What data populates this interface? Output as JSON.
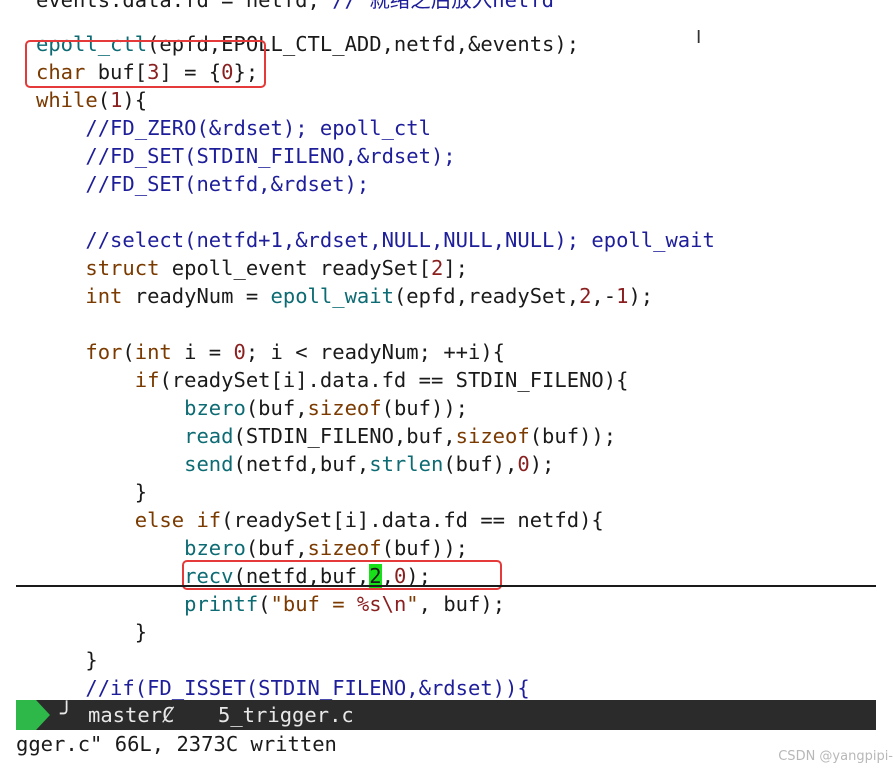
{
  "editor": {
    "lines": [
      [
        [
          "def",
          "events.data.fd = netfd; "
        ],
        [
          "cm",
          "// 就绪之后放入netfd"
        ]
      ],
      [
        [
          "fn",
          "epoll_ctl"
        ],
        [
          "def",
          "(epfd,EPOLL_CTL_ADD,netfd,&events);"
        ]
      ],
      [
        [
          "kw",
          "char"
        ],
        [
          "def",
          " buf["
        ],
        [
          "num",
          "3"
        ],
        [
          "def",
          "] = {"
        ],
        [
          "num",
          "0"
        ],
        [
          "def",
          "};"
        ]
      ],
      [
        [
          "kw",
          "while"
        ],
        [
          "def",
          "("
        ],
        [
          "num",
          "1"
        ],
        [
          "def",
          "){"
        ]
      ],
      [
        [
          "def",
          "    "
        ],
        [
          "cm",
          "//FD_ZERO(&rdset); epoll_ctl"
        ]
      ],
      [
        [
          "def",
          "    "
        ],
        [
          "cm",
          "//FD_SET(STDIN_FILENO,&rdset);"
        ]
      ],
      [
        [
          "def",
          "    "
        ],
        [
          "cm",
          "//FD_SET(netfd,&rdset);"
        ]
      ],
      [
        [
          "def",
          ""
        ]
      ],
      [
        [
          "def",
          "    "
        ],
        [
          "cm",
          "//select(netfd+1,&rdset,NULL,NULL,NULL); epoll_wait"
        ]
      ],
      [
        [
          "def",
          "    "
        ],
        [
          "kw",
          "struct"
        ],
        [
          "def",
          " epoll_event readySet["
        ],
        [
          "num",
          "2"
        ],
        [
          "def",
          "];"
        ]
      ],
      [
        [
          "def",
          "    "
        ],
        [
          "kw",
          "int"
        ],
        [
          "def",
          " readyNum = "
        ],
        [
          "fn",
          "epoll_wait"
        ],
        [
          "def",
          "(epfd,readySet,"
        ],
        [
          "num",
          "2"
        ],
        [
          "def",
          ",-"
        ],
        [
          "num",
          "1"
        ],
        [
          "def",
          ");"
        ]
      ],
      [
        [
          "def",
          ""
        ]
      ],
      [
        [
          "def",
          "    "
        ],
        [
          "kw",
          "for"
        ],
        [
          "def",
          "("
        ],
        [
          "kw",
          "int"
        ],
        [
          "def",
          " i = "
        ],
        [
          "num",
          "0"
        ],
        [
          "def",
          "; i < readyNum; ++i){"
        ]
      ],
      [
        [
          "def",
          "        "
        ],
        [
          "kw",
          "if"
        ],
        [
          "def",
          "(readySet[i].data.fd == STDIN_FILENO){"
        ]
      ],
      [
        [
          "def",
          "            "
        ],
        [
          "fn",
          "bzero"
        ],
        [
          "def",
          "(buf,"
        ],
        [
          "kw",
          "sizeof"
        ],
        [
          "def",
          "(buf));"
        ]
      ],
      [
        [
          "def",
          "            "
        ],
        [
          "fn",
          "read"
        ],
        [
          "def",
          "(STDIN_FILENO,buf,"
        ],
        [
          "kw",
          "sizeof"
        ],
        [
          "def",
          "(buf));"
        ]
      ],
      [
        [
          "def",
          "            "
        ],
        [
          "fn",
          "send"
        ],
        [
          "def",
          "(netfd,buf,"
        ],
        [
          "fn",
          "strlen"
        ],
        [
          "def",
          "(buf),"
        ],
        [
          "num",
          "0"
        ],
        [
          "def",
          ");"
        ]
      ],
      [
        [
          "def",
          "        }"
        ]
      ],
      [
        [
          "def",
          "        "
        ],
        [
          "kw",
          "else"
        ],
        [
          "def",
          " "
        ],
        [
          "kw",
          "if"
        ],
        [
          "def",
          "(readySet[i].data.fd == netfd){"
        ]
      ],
      [
        [
          "def",
          "            "
        ],
        [
          "fn",
          "bzero"
        ],
        [
          "def",
          "(buf,"
        ],
        [
          "kw",
          "sizeof"
        ],
        [
          "def",
          "(buf));"
        ]
      ],
      [
        [
          "def",
          "            "
        ],
        [
          "fn",
          "recv"
        ],
        [
          "def",
          "(netfd,buf,"
        ],
        [
          "hl",
          "2"
        ],
        [
          "def",
          ","
        ],
        [
          "num",
          "0"
        ],
        [
          "def",
          ");"
        ]
      ],
      [
        [
          "def",
          "            "
        ],
        [
          "fn",
          "printf"
        ],
        [
          "def",
          "("
        ],
        [
          "str",
          "\"buf = "
        ],
        [
          "num",
          "%s\\n"
        ],
        [
          "str",
          "\""
        ],
        [
          "def",
          ", buf);"
        ]
      ],
      [
        [
          "def",
          "        }"
        ]
      ],
      [
        [
          "def",
          "    }"
        ]
      ],
      [
        [
          "def",
          "    "
        ],
        [
          "cm",
          "//if(FD_ISSET(STDIN_FILENO,&rdset)){"
        ]
      ]
    ]
  },
  "statusbar": {
    "branch": "master",
    "branch_icon": "git-branch-icon",
    "dirty_flag": "Ȼ",
    "filename": "5_trigger.c"
  },
  "cmdline": {
    "message": "gger.c\" 66L, 2373C written"
  },
  "watermark": {
    "text": "CSDN @yangpipi-"
  },
  "colors": {
    "keyword": "#7a3a00",
    "function": "#0d6b73",
    "number": "#8a1f1f",
    "comment": "#1e1e9a",
    "highlight": "#18e018",
    "annotation_box": "#e43a3a",
    "statusbar_bg": "#2b2b2b",
    "mode_green": "#2fb84a"
  }
}
